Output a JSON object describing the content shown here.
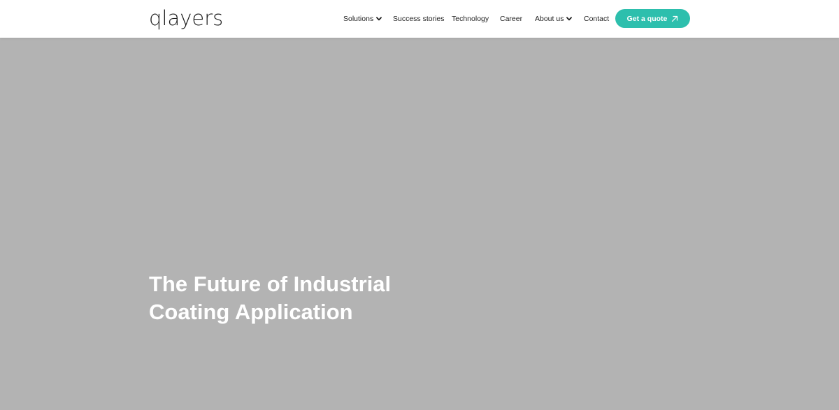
{
  "brand": {
    "logo_text": "qlayers"
  },
  "nav": {
    "items": [
      {
        "label": "Solutions",
        "has_dropdown": true
      },
      {
        "label": "Success stories",
        "has_dropdown": false
      },
      {
        "label": "Technology",
        "has_dropdown": false
      },
      {
        "label": "Career",
        "has_dropdown": false
      },
      {
        "label": "About us",
        "has_dropdown": true
      },
      {
        "label": "Contact",
        "has_dropdown": false
      }
    ],
    "cta_label": "Get a quote",
    "cta_icon": "arrow-up-right-icon"
  },
  "hero": {
    "title_line_1": "The Future of Industrial",
    "title_line_2": "Coating Application"
  },
  "colors": {
    "accent": "#2dbfad",
    "hero_background": "#b3b3b3",
    "header_background": "#ffffff",
    "text_dark": "#1f1f1f"
  }
}
